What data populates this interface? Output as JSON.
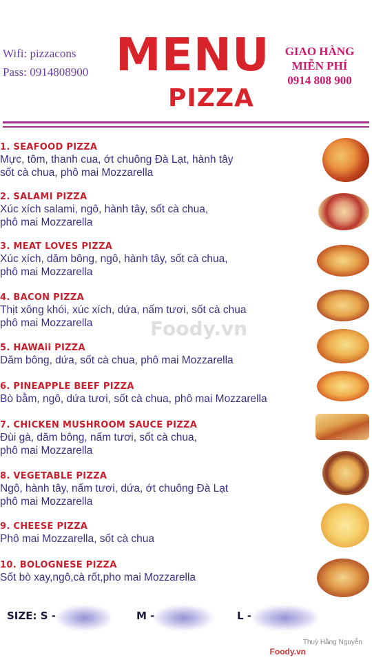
{
  "header": {
    "wifi": "Wifi: pizzacons",
    "pass": "Pass: 0914808900",
    "title": "MENU",
    "subtitle": "PIZZA",
    "delivery_line1": "GIAO HÀNG",
    "delivery_line2": "MIỄN PHÍ",
    "delivery_phone": "0914 808 900"
  },
  "items": [
    {
      "name": "1. SEAFOOD PIZZA",
      "desc1": "Mực, tôm, thanh cua, ớt chuông Đà Lạt, hành tây",
      "desc2": "sốt cà chua, phô mai Mozzarella"
    },
    {
      "name": "2. SALAMI PIZZA",
      "desc1": "Xúc xích salami, ngô, hành tây, sốt cà chua,",
      "desc2": "phô mai Mozzarella"
    },
    {
      "name": "3. MEAT LOVES PIZZA",
      "desc1": "Xúc xích, dăm bông, ngô, hành tây, sốt cà chua,",
      "desc2": "phô mai Mozzarella"
    },
    {
      "name": "4. BACON PIZZA",
      "desc1": "Thịt xông khói, xúc xích, dứa, nấm tươi, sốt cà chua",
      "desc2": "phô mai Mozzarella"
    },
    {
      "name": "5. HAWAii PIZZA",
      "desc1": "Dăm bông, dứa, sốt cà chua, phô mai Mozzarella",
      "desc2": ""
    },
    {
      "name": "6. PINEAPPLE BEEF PIZZA",
      "desc1": "Bò bằm, ngô, dứa tươi, sốt cà chua, phô mai Mozzarella",
      "desc2": ""
    },
    {
      "name": "7. CHICKEN MUSHROOM SAUCE PIZZA",
      "desc1": "Đùi gà, dăm bông, nấm tươi, sốt cà chua,",
      "desc2": "phô mai Mozzarella"
    },
    {
      "name": "8. VEGETABLE PIZZA",
      "desc1": "Ngô, hành tây, nấm tươi, dứa, ớt chuông Đà Lạt",
      "desc2": "phô mai Mozzarella"
    },
    {
      "name": "9. CHEESE PIZZA",
      "desc1": "Phô mai Mozzarella, sốt cà chua",
      "desc2": ""
    },
    {
      "name": "10. BOLOGNESE PIZZA",
      "desc1": "Sốt bò xay,ngô,cà rốt,pho mai Mozzarella",
      "desc2": ""
    }
  ],
  "sizes": {
    "s": "SIZE: S -",
    "m": "M -",
    "l": "L -"
  },
  "watermark": "Foody.vn",
  "credit": "Thuỳ Hằng Nguyễn",
  "credit_logo": "Foody.vn",
  "colors": {
    "title": "#d8232a",
    "item_name": "#c8202c",
    "desc": "#3a2f86",
    "rule": "#a0308a",
    "delivery": "#d0176e"
  }
}
